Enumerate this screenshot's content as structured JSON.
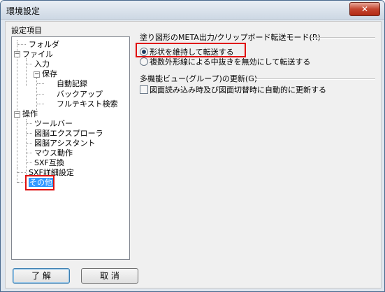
{
  "window": {
    "title": "環境設定",
    "close_label": "✕"
  },
  "tree": {
    "group_label": "設定項目",
    "items": [
      {
        "label": "フォルダ"
      },
      {
        "label": "ファイル",
        "expander": "−"
      },
      {
        "label": "入力"
      },
      {
        "label": "保存",
        "expander": "−"
      },
      {
        "label": "自動記録"
      },
      {
        "label": "バックアップ"
      },
      {
        "label": "フルテキスト検索"
      },
      {
        "label": "操作",
        "expander": "−"
      },
      {
        "label": "ツールバー"
      },
      {
        "label": "図脳エクスプローラ"
      },
      {
        "label": "図脳アシスタント"
      },
      {
        "label": "マウス動作"
      },
      {
        "label": "SXF互換"
      },
      {
        "label": "SXF詳細設定"
      },
      {
        "label": "その他",
        "selected": true
      }
    ]
  },
  "section1": {
    "title": "塗り図形のMETA出力/クリップボード転送モード(R)",
    "options": [
      {
        "label": "形状を維持して転送する",
        "checked": true
      },
      {
        "label": "複数外形線による中抜きを無効にして転送する",
        "checked": false
      }
    ]
  },
  "section2": {
    "title": "多機能ビュー(グループ)の更新(G)",
    "checkbox_label": "図面読み込み時及び図面切替時に自動的に更新する",
    "checked": false
  },
  "buttons": {
    "ok": "了 解",
    "cancel": "取 消"
  }
}
